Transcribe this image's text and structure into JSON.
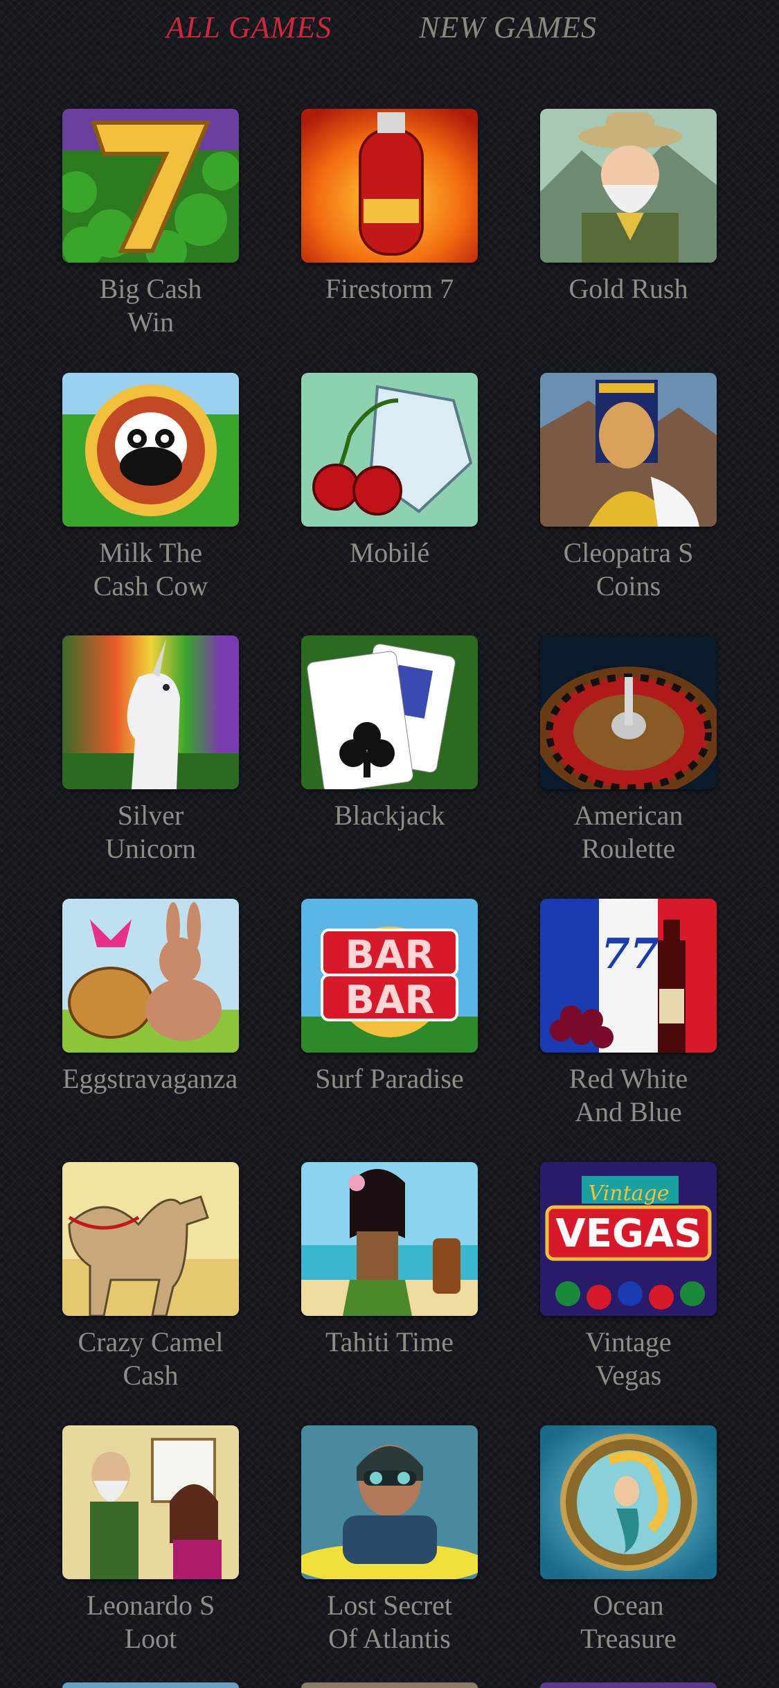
{
  "tabs": [
    {
      "label": "ALL GAMES",
      "active": true
    },
    {
      "label": "NEW GAMES",
      "active": false
    }
  ],
  "colors": {
    "active_tab": "#d0283b",
    "inactive_tab": "#8a8a7c",
    "label": "#8f8e86",
    "background": "#15161b"
  },
  "games": [
    {
      "name": "Big Cash Win",
      "line1": "Big Cash",
      "line2": "Win",
      "icon": "golden-seven-icon"
    },
    {
      "name": "Firestorm 7",
      "line1": "Firestorm 7",
      "line2": "",
      "icon": "fire-extinguisher-icon"
    },
    {
      "name": "Gold Rush",
      "line1": "Gold Rush",
      "line2": "",
      "icon": "prospector-icon"
    },
    {
      "name": "Milk The Cash Cow",
      "line1": "Milk The",
      "line2": "Cash Cow",
      "icon": "cow-badge-icon"
    },
    {
      "name": "Mobilé",
      "line1": "Mobilé",
      "line2": "",
      "icon": "diamond-cherries-icon"
    },
    {
      "name": "Cleopatra S Coins",
      "line1": "Cleopatra S",
      "line2": "Coins",
      "icon": "cleopatra-icon"
    },
    {
      "name": "Silver Unicorn",
      "line1": "Silver",
      "line2": "Unicorn",
      "icon": "unicorn-icon"
    },
    {
      "name": "Blackjack",
      "line1": "Blackjack",
      "line2": "",
      "icon": "playing-cards-icon"
    },
    {
      "name": "American Roulette",
      "line1": "American",
      "line2": "Roulette",
      "icon": "roulette-wheel-icon"
    },
    {
      "name": "Eggstravaganza",
      "line1": "Eggstravaganza",
      "line2": "",
      "icon": "bunny-basket-icon"
    },
    {
      "name": "Surf Paradise",
      "line1": "Surf Paradise",
      "line2": "",
      "icon": "bar-bar-icon",
      "thumb_text": [
        "BAR",
        "BAR"
      ]
    },
    {
      "name": "Red White And Blue",
      "line1": "Red White",
      "line2": "And Blue",
      "icon": "wine-grapes-icon",
      "thumb_text": [
        "77"
      ]
    },
    {
      "name": "Crazy Camel Cash",
      "line1": "Crazy Camel",
      "line2": "Cash",
      "icon": "camel-icon"
    },
    {
      "name": "Tahiti Time",
      "line1": "Tahiti Time",
      "line2": "",
      "icon": "hula-girl-icon"
    },
    {
      "name": "Vintage Vegas",
      "line1": "Vintage",
      "line2": "Vegas",
      "icon": "vegas-sign-icon",
      "thumb_text": [
        "Vintage",
        "VEGAS"
      ]
    },
    {
      "name": "Leonardo S Loot",
      "line1": "Leonardo S",
      "line2": "Loot",
      "icon": "painter-icon"
    },
    {
      "name": "Lost Secret Of Atlantis",
      "line1": "Lost Secret",
      "line2": "Of Atlantis",
      "icon": "diver-icon"
    },
    {
      "name": "Ocean Treasure",
      "line1": "Ocean",
      "line2": "Treasure",
      "icon": "mermaid-porthole-icon"
    }
  ]
}
